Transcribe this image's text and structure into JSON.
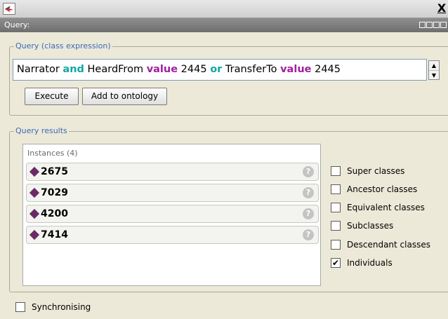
{
  "window": {
    "close_label": "X"
  },
  "view": {
    "title": "Query:"
  },
  "query": {
    "group_title": "Query (class expression)",
    "expression_tokens": [
      {
        "text": "Narrator ",
        "kind": "plain"
      },
      {
        "text": "and",
        "kind": "and"
      },
      {
        "text": " HeardFrom ",
        "kind": "plain"
      },
      {
        "text": "value",
        "kind": "value"
      },
      {
        "text": " 2445 ",
        "kind": "plain"
      },
      {
        "text": "or",
        "kind": "or"
      },
      {
        "text": " TransferTo ",
        "kind": "plain"
      },
      {
        "text": "value",
        "kind": "value"
      },
      {
        "text": " 2445",
        "kind": "plain"
      }
    ],
    "execute_label": "Execute",
    "add_label": "Add to ontology"
  },
  "results": {
    "group_title": "Query results",
    "list_header": "Instances (4)",
    "instances": [
      "2675",
      "7029",
      "4200",
      "7414"
    ],
    "help_glyph": "?",
    "options": [
      {
        "label": "Super classes",
        "checked": false
      },
      {
        "label": "Ancestor classes",
        "checked": false
      },
      {
        "label": "Equivalent classes",
        "checked": false
      },
      {
        "label": "Subclasses",
        "checked": false
      },
      {
        "label": "Descendant classes",
        "checked": false
      },
      {
        "label": "Individuals",
        "checked": true
      }
    ]
  },
  "sync": {
    "label": "Synchronising",
    "checked": false
  },
  "colors": {
    "keyword_logic": "#15a5a5",
    "keyword_value": "#a020a0",
    "individual_diamond": "#6b2a66",
    "group_title": "#3c69b8"
  }
}
